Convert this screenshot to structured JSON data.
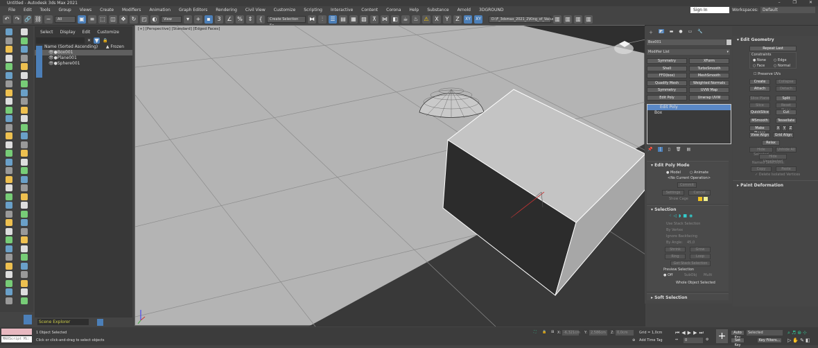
{
  "window": {
    "title": "Untitled - Autodesk 3ds Max 2021",
    "controls": [
      "–",
      "❐",
      "✕"
    ]
  },
  "menu": [
    "File",
    "Edit",
    "Tools",
    "Group",
    "Views",
    "Create",
    "Modifiers",
    "Animation",
    "Graph Editors",
    "Rendering",
    "Civil View",
    "Customize",
    "Scripting",
    "Interactive",
    "Content",
    "Corona",
    "Help",
    "Substance",
    "Arnold",
    "3DGROUND"
  ],
  "account": {
    "sign_in": "Sign In",
    "workspaces_label": "Workspaces:",
    "workspace": "Default"
  },
  "toolbar": {
    "filter": "All",
    "ref_coord": "View",
    "selection_set": "Create Selection Se",
    "axes": [
      "X",
      "Y",
      "Z",
      "XY",
      "XY"
    ],
    "project_path": "D:\\F_3dsmax_2021_2\\King_of_Vacuum"
  },
  "scene_explorer": {
    "tabs": [
      "Select",
      "Display",
      "Edit",
      "Customize"
    ],
    "col_name": "Name (Sorted Ascending)",
    "col_frozen": "▲ Frozen",
    "objects": [
      {
        "name": "Box001",
        "selected": true
      },
      {
        "name": "Plane001",
        "selected": false
      },
      {
        "name": "Sphere001",
        "selected": false
      }
    ],
    "explorer_name": "Scene Explorer"
  },
  "viewport": {
    "label": "[+] [Perspective] [Standard] [Edged Faces]"
  },
  "command_panel": {
    "object_name": "Box001",
    "object_color": "#c8c8c8",
    "modifier_list": "Modifier List",
    "modifier_buttons": [
      "Symmetry",
      "XForm",
      "Shell",
      "TurboSmooth",
      "FFD(box)",
      "MeshSmooth",
      "Quadify Mesh",
      "Weighted Normals",
      "Symmetry",
      "UVW Map",
      "Edit Poly",
      "Unwrap UVW"
    ],
    "stack": [
      "Edit Poly",
      "Box"
    ],
    "edit_poly_mode": {
      "title": "Edit Poly Mode",
      "model": "Model",
      "animate": "Animate",
      "operation": "<No Current Operation>",
      "commit": "Commit",
      "settings": "Settings",
      "cancel": "Cancel",
      "show_cage": "Show Cage",
      "cage_colors": [
        "#f0c020",
        "#f0f090"
      ]
    },
    "selection": {
      "title": "Selection",
      "use_stack": "Use Stack Selection",
      "by_vertex": "By Vertex",
      "ignore_backfacing": "Ignore Backfacing",
      "by_angle": "By Angle:",
      "angle": "45,0",
      "shrink": "Shrink",
      "grow": "Grow",
      "ring": "Ring",
      "loop": "Loop",
      "get_stack": "Get Stack Selection",
      "preview": "Preview Selection",
      "off": "Off",
      "subobj": "SubObj",
      "multi": "Multi",
      "status": "Whole Object Selected"
    },
    "soft_selection": "Soft Selection"
  },
  "edit_geometry": {
    "title": "Edit Geometry",
    "repeat_last": "Repeat Last",
    "constraints": "Constraints",
    "none": "None",
    "edge": "Edge",
    "face": "Face",
    "normal": "Normal",
    "preserve_uvs": "Preserve UVs",
    "create": "Create",
    "collapse": "Collapse",
    "attach": "Attach",
    "detach": "Detach",
    "slice_plane": "Slice Plane",
    "split": "Split",
    "slice": "Slice",
    "reset_plane": "Reset Plane",
    "quickslice": "QuickSlice",
    "cut": "Cut",
    "msmooth": "MSmooth",
    "tessellate": "Tessellate",
    "make_planar": "Make Planar",
    "x": "X",
    "y": "Y",
    "z": "Z",
    "view_align": "View Align",
    "grid_align": "Grid Align",
    "relax": "Relax",
    "hide_selected": "Hide Selected",
    "unhide_all": "Unhide All",
    "hide_unselected": "Hide Unselected",
    "named_selections": "Named Selections:",
    "copy": "Copy",
    "paste": "Paste",
    "delete_isolated": "Delete Isolated Vertices",
    "paint_deformation": "Paint Deformation"
  },
  "status": {
    "maxscript": "MAXScript Mi:",
    "objects_selected": "1 Object Selected",
    "prompt": "Click or click-and-drag to select objects",
    "x": "-6,321cm",
    "y": "2,586cm",
    "z": "0,0cm",
    "grid": "Grid = 1,0cm",
    "add_time_tag": "Add Time Tag",
    "frame": "0",
    "auto_key": "Auto Key",
    "key_mode": "Selected",
    "set_key": "Set Key",
    "key_filters": "Key Filters..."
  }
}
